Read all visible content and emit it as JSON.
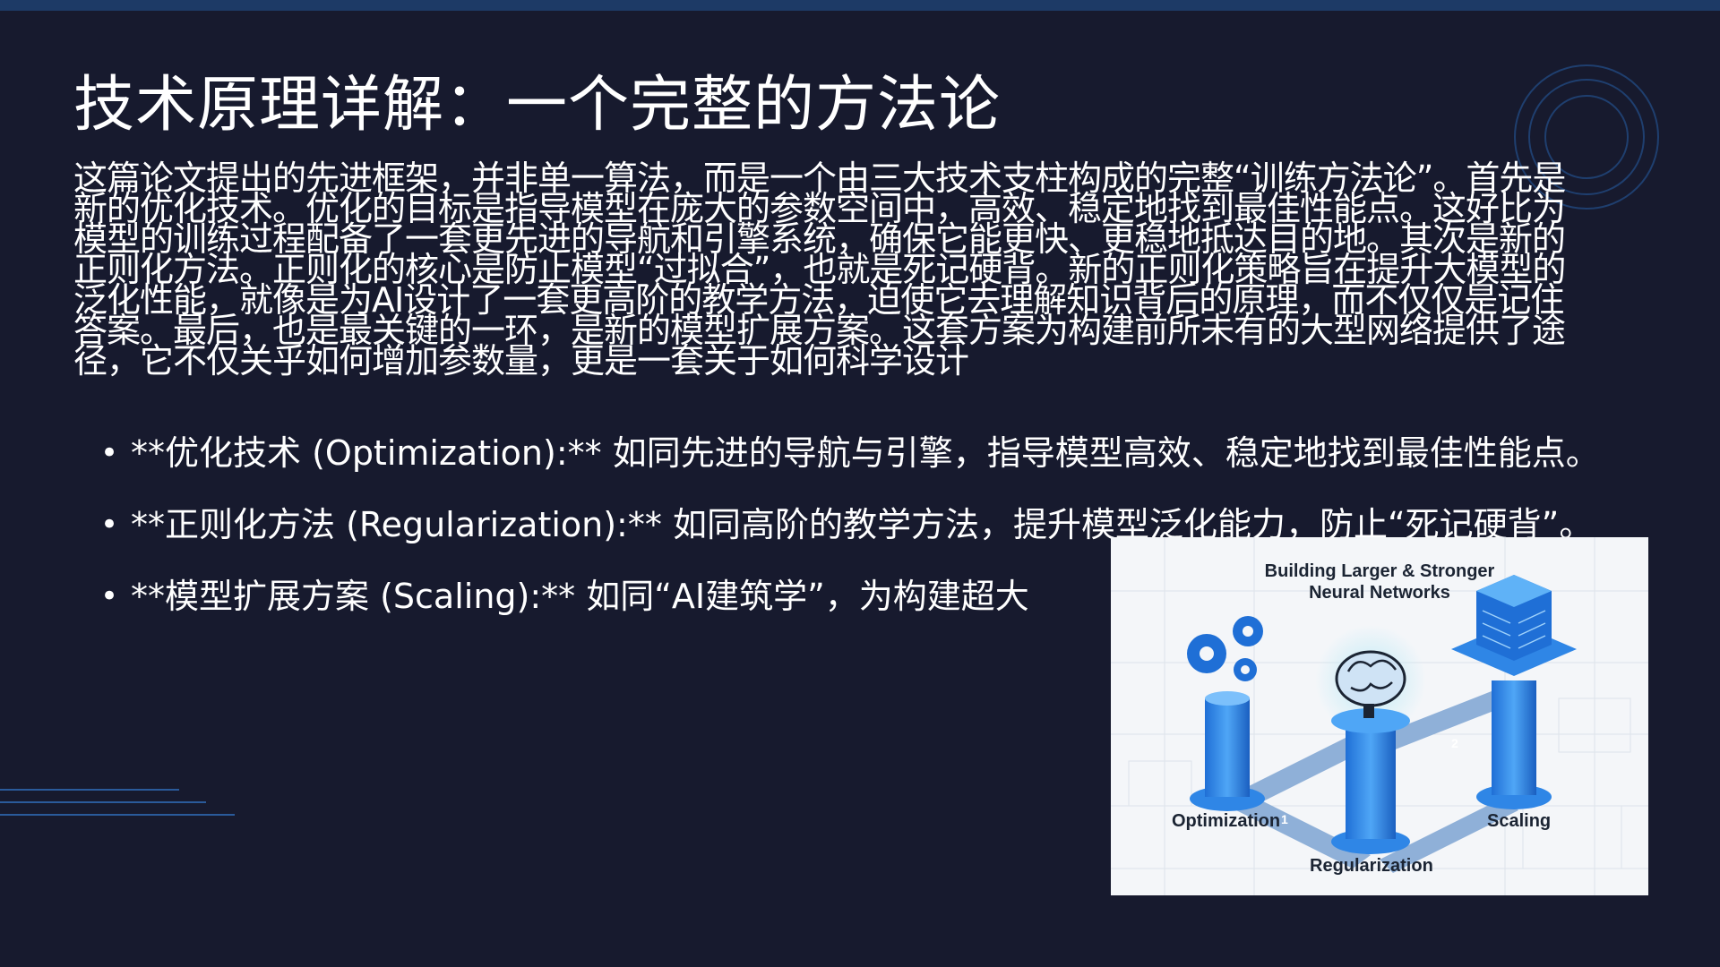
{
  "slide": {
    "title": "技术原理详解：一个完整的方法论",
    "paragraph": "这篇论文提出的先进框架，并非单一算法，而是一个由三大技术支柱构成的完整“训练方法论”。首先是新的优化技术。优化的目标是指导模型在庞大的参数空间中，高效、稳定地找到最佳性能点。这好比为模型的训练过程配备了一套更先进的导航和引擎系统，确保它能更快、更稳地抵达目的地。其次是新的正则化方法。正则化的核心是防止模型“过拟合”，也就是死记硬背。新的正则化策略旨在提升大模型的泛化性能，就像是为AI设计了一套更高阶的教学方法，迫使它去理解知识背后的原理，而不仅仅是记住答案。最后，也是最关键的一环，是新的模型扩展方案。这套方案为构建前所未有的大型网络提供了途径，它不仅关乎如何增加参数量，更是一套关于如何科学设计",
    "bullets": [
      "**优化技术 (Optimization):** 如同先进的导航与引擎，指导模型高效、稳定地找到最佳性能点。",
      "**正则化方法 (Regularization):** 如同高阶的教学方法，提升模型泛化能力，防止“死记硬背”。",
      "**模型扩展方案 (Scaling):** 如同“AI建筑学”，为构建超大"
    ],
    "bullet_glyph": "•"
  },
  "figure": {
    "title_line1": "Building Larger & Stronger",
    "title_line2": "Neural Networks",
    "labels": {
      "optimization": "Optimization",
      "regularization": "Regularization",
      "scaling": "Scaling"
    },
    "path_numbers": [
      "1",
      "2"
    ],
    "icons": [
      "gears-icon",
      "brain-icon",
      "building-icon"
    ]
  },
  "colors": {
    "background": "#171a2e",
    "top_bar": "#1d3a66",
    "accent_line": "#2a5a9a",
    "pillar_blue": "#2f86e6",
    "figure_bg": "#f4f6f9"
  }
}
